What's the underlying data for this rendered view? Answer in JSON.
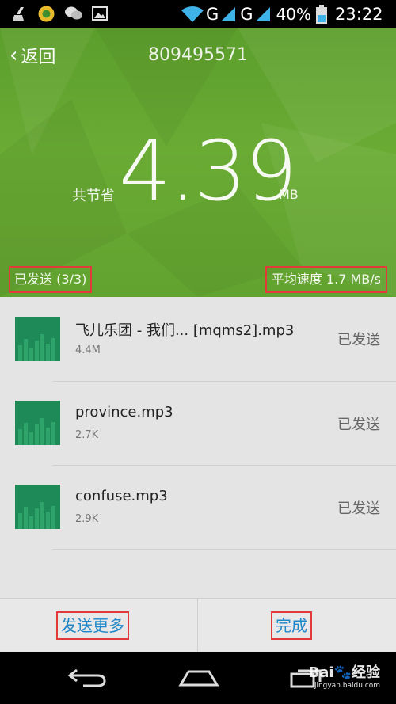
{
  "status_bar": {
    "network_1": "G",
    "network_2": "G",
    "battery": "40%",
    "time": "23:22",
    "icons": [
      "broom-icon",
      "app-icon",
      "wechat-icon",
      "image-icon",
      "wifi-icon",
      "signal-icon",
      "battery-icon"
    ]
  },
  "header": {
    "back_label": "返回",
    "title": "809495571",
    "saved_label": "共节省",
    "saved_value": "4.39",
    "saved_unit": "MB",
    "sent_count": "已发送 (3/3)",
    "avg_speed": "平均速度 1.7 MB/s",
    "bg_color": "#62a22f"
  },
  "files": [
    {
      "name": "飞儿乐团 - 我们... [mqms2].mp3",
      "size": "4.4M",
      "status": "已发送"
    },
    {
      "name": "province.mp3",
      "size": "2.7K",
      "status": "已发送"
    },
    {
      "name": "confuse.mp3",
      "size": "2.9K",
      "status": "已发送"
    }
  ],
  "actions": {
    "send_more": "发送更多",
    "done": "完成",
    "link_color": "#1f86c9"
  },
  "watermark": {
    "brand": "Bai",
    "brand2": "经验",
    "url": "jingyan.baidu.com"
  }
}
